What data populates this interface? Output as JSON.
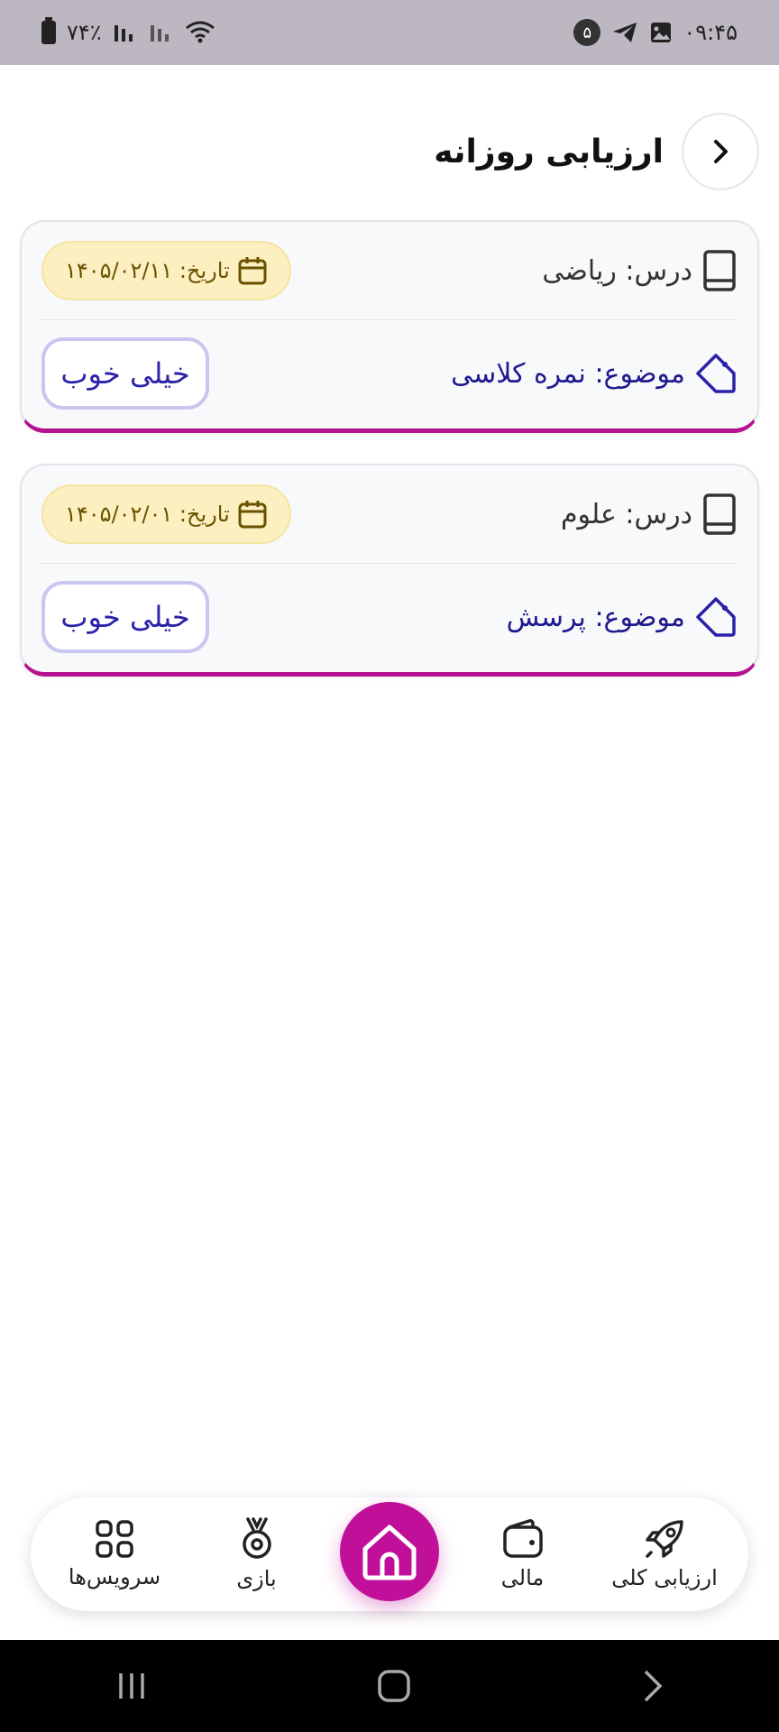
{
  "status_bar": {
    "time": "۰۹:۴۵",
    "notification_count": "۵",
    "battery": "۷۴٪"
  },
  "header": {
    "title": "ارزیابی روزانه"
  },
  "cards": [
    {
      "lesson": "درس: ریاضی",
      "date": "تاریخ: ۱۴۰۵/۰۲/۱۱",
      "topic": "موضوع: نمره کلاسی",
      "grade": "خیلی خوب"
    },
    {
      "lesson": "درس: علوم",
      "date": "تاریخ: ۱۴۰۵/۰۲/۰۱",
      "topic": "موضوع: پرسش",
      "grade": "خیلی خوب"
    }
  ],
  "bottom_nav": {
    "items": [
      {
        "label": "ارزیابی کلی",
        "icon": "rocket-icon"
      },
      {
        "label": "مالی",
        "icon": "wallet-icon"
      },
      {
        "label": "",
        "icon": "home-icon"
      },
      {
        "label": "بازی",
        "icon": "medal-icon"
      },
      {
        "label": "سرویس‌ها",
        "icon": "grid-icon"
      }
    ]
  },
  "colors": {
    "accent": "#c0109a",
    "topic": "#1e1a8f",
    "date_pill": "#fcefc0"
  }
}
